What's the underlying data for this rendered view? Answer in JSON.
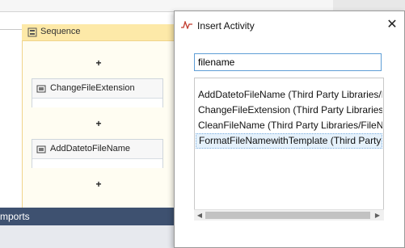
{
  "designer": {
    "sequence_label": "Sequence",
    "plus_symbol": "+",
    "activities": [
      {
        "label": "ChangeFileExtension"
      },
      {
        "label": "AddDatetoFileName"
      }
    ],
    "imports_label": "mports"
  },
  "dialog": {
    "title": "Insert Activity",
    "close_glyph": "✕",
    "search_value": "filename",
    "results": [
      {
        "label": "AddDatetoFileName (Third Party Libraries/File",
        "selected": false
      },
      {
        "label": "ChangeFileExtension (Third Party Libraries/Fi",
        "selected": false
      },
      {
        "label": "CleanFileName (Third Party Libraries/FileNam",
        "selected": false
      },
      {
        "label": "FormatFileNamewithTemplate (Third Party Li",
        "selected": true
      }
    ],
    "scroll_left_glyph": "◀",
    "scroll_right_glyph": "▶"
  },
  "colors": {
    "accent": "#5f9ed6",
    "selection": "#e5f1fb",
    "imports_bar": "#3e5170",
    "sequence_header": "#fde9a8"
  },
  "icons": {
    "sequence": "sequence-icon",
    "activity": "activity-icon",
    "dialog": "activity-wave-icon"
  }
}
